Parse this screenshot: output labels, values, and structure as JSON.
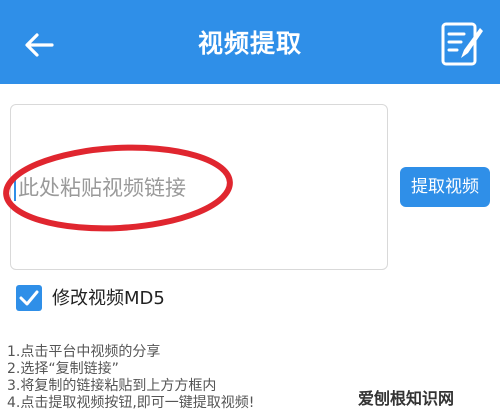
{
  "header": {
    "title": "视频提取",
    "back_icon": "arrow-left-icon",
    "action_icon": "edit-note-icon",
    "background": "#2f8fe8"
  },
  "input": {
    "placeholder": "此处粘贴视频链接",
    "value": ""
  },
  "extract_button": {
    "label": "提取视频"
  },
  "options": {
    "modify_md5": {
      "label": "修改视频MD5",
      "checked": true
    }
  },
  "instructions": [
    "1.点击平台中视频的分享",
    "2.选择“复制链接”",
    "3.将复制的链接粘贴到上方方框内",
    "4.点击提取视频按钮,即可一键提取视频!"
  ],
  "annotation": {
    "color": "#e0262f"
  },
  "watermark": {
    "text": "爱刨根知识网"
  }
}
